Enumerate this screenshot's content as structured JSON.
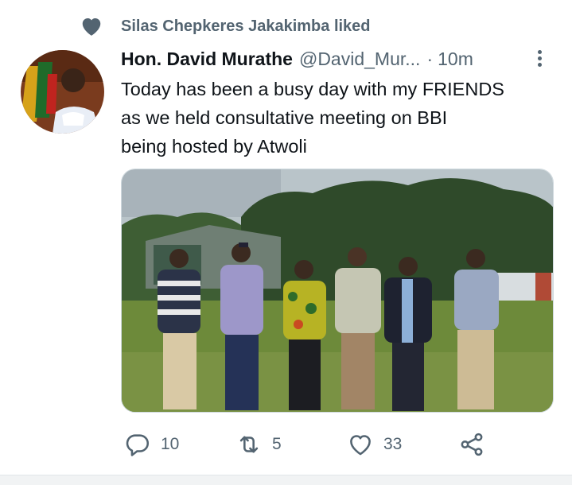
{
  "social_context": {
    "text": "Silas Chepkeres Jakakimba liked",
    "icon": "heart-icon"
  },
  "tweet": {
    "display_name": "Hon. David Murathe",
    "handle": "@David_Mur...",
    "separator": "·",
    "time": "10m",
    "text": "Today has been a busy day with my FRIENDS\nas we held consultative meeting on BBI\nbeing hosted by Atwoli"
  },
  "actions": {
    "replies": {
      "icon": "reply-icon",
      "count": "10"
    },
    "retweets": {
      "icon": "retweet-icon",
      "count": "5"
    },
    "likes": {
      "icon": "like-icon",
      "count": "33"
    },
    "share": {
      "icon": "share-icon"
    }
  },
  "colors": {
    "muted": "#536471",
    "text": "#0f1419",
    "heart": "#536471"
  }
}
